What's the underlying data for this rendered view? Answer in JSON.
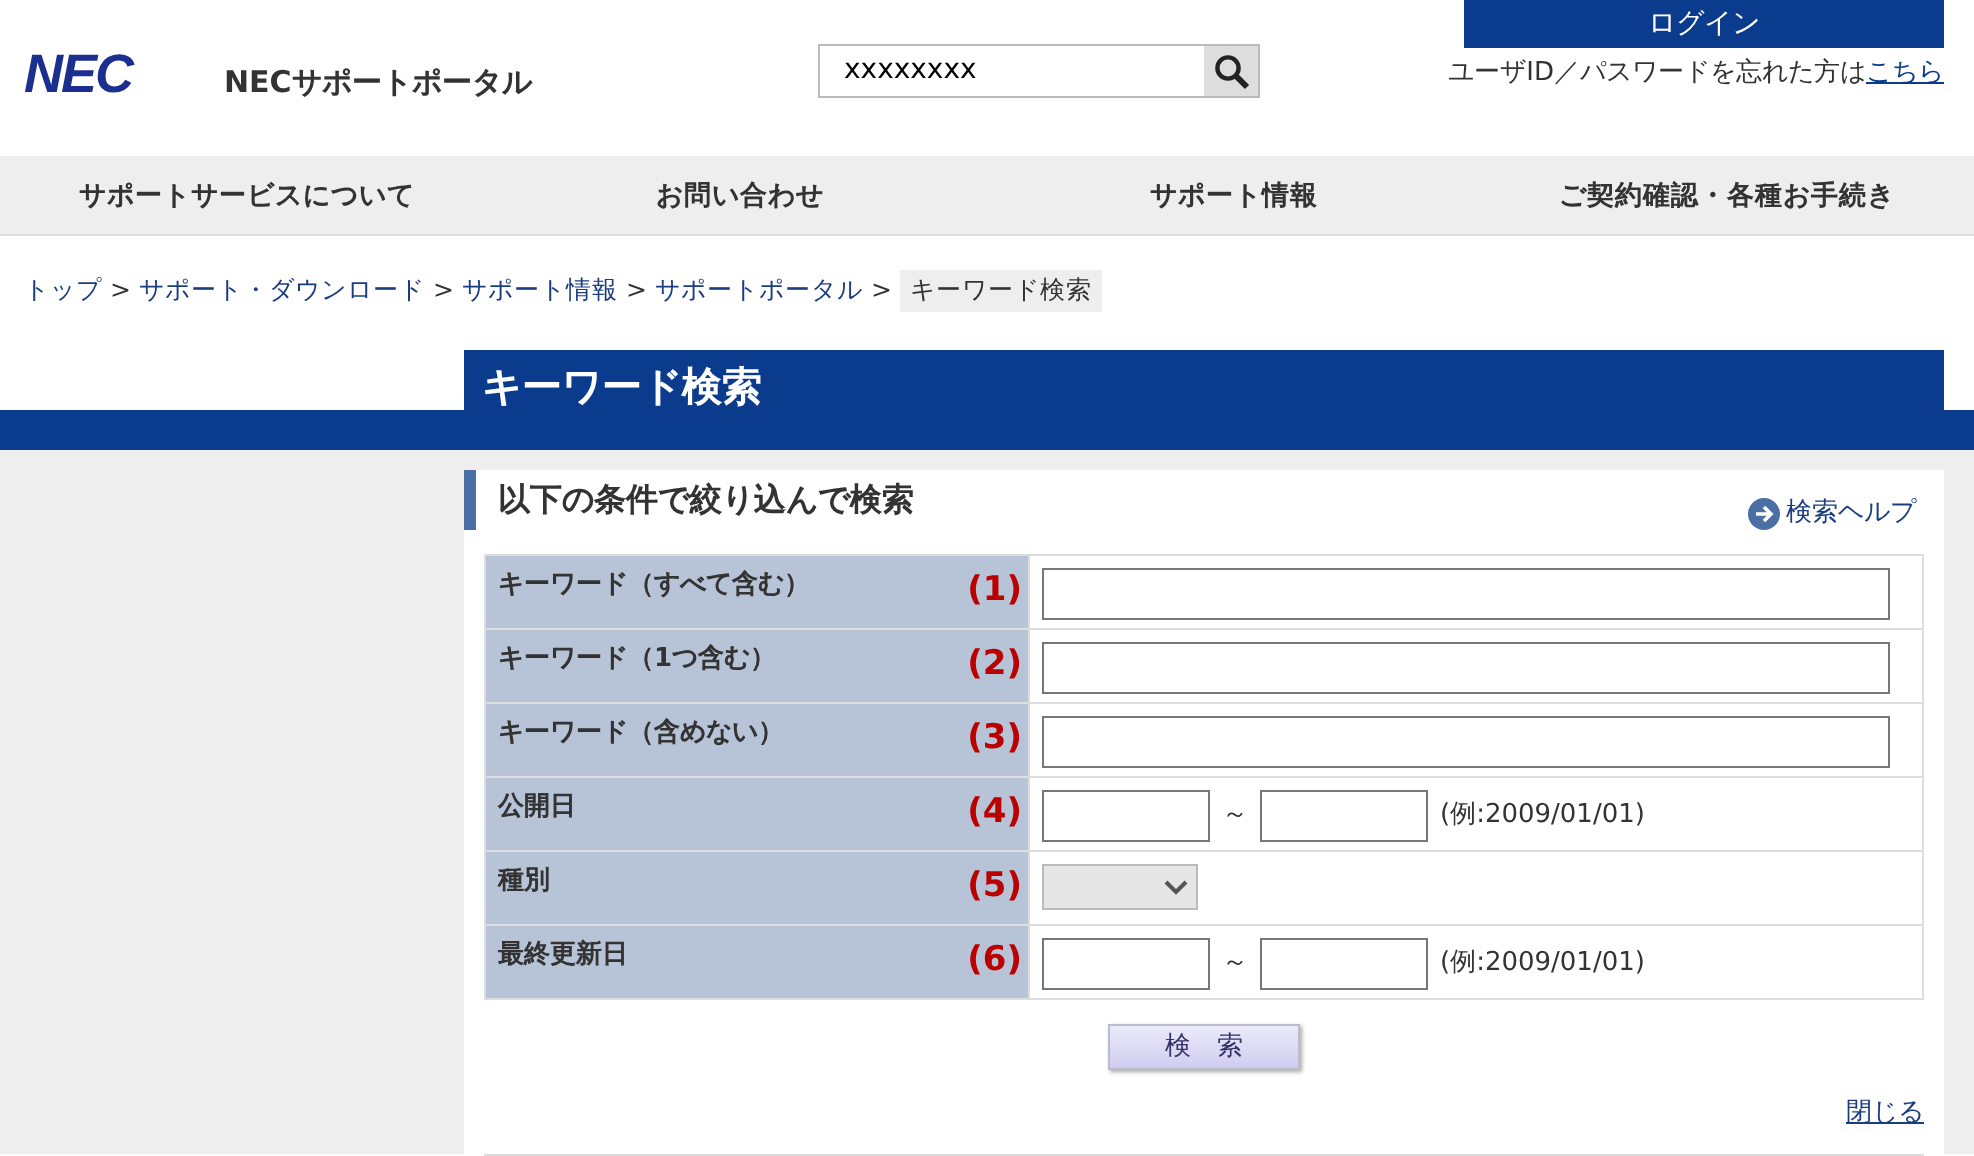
{
  "header": {
    "logo": "NEC",
    "site_title": "NECサポートポータル",
    "search": {
      "value": "xxxxxxxx"
    },
    "login_button": "ログイン",
    "forgot_text": "ユーザID／パスワードを忘れた方は",
    "forgot_link": "こちら"
  },
  "nav": [
    "サポートサービスについて",
    "お問い合わせ",
    "サポート情報",
    "ご契約確認・各種お手続き"
  ],
  "breadcrumb": [
    {
      "label": "トップ",
      "current": false
    },
    {
      "label": "サポート・ダウンロード",
      "current": false
    },
    {
      "label": "サポート情報",
      "current": false
    },
    {
      "label": "サポートポータル",
      "current": false
    },
    {
      "label": "キーワード検索",
      "current": true
    }
  ],
  "breadcrumb_separator": ">",
  "page_title": "キーワード検索",
  "section": {
    "title": "以下の条件で絞り込んで検索",
    "help_link": "検索ヘルプ"
  },
  "form_rows": [
    {
      "label": "キーワード（すべて含む）",
      "number": "(1)",
      "kind": "text"
    },
    {
      "label": "キーワード（1つ含む）",
      "number": "(2)",
      "kind": "text"
    },
    {
      "label": "キーワード（含めない）",
      "number": "(3)",
      "kind": "text"
    },
    {
      "label": "公開日",
      "number": "(4)",
      "kind": "date",
      "separator": "～",
      "example": "(例:2009/01/01)"
    },
    {
      "label": "種別",
      "number": "(5)",
      "kind": "select",
      "disabled": true
    },
    {
      "label": "最終更新日",
      "number": "(6)",
      "kind": "date",
      "separator": "～",
      "example": "(例:2009/01/01)"
    }
  ],
  "search_button": "検　索",
  "close_link": "閉じる"
}
